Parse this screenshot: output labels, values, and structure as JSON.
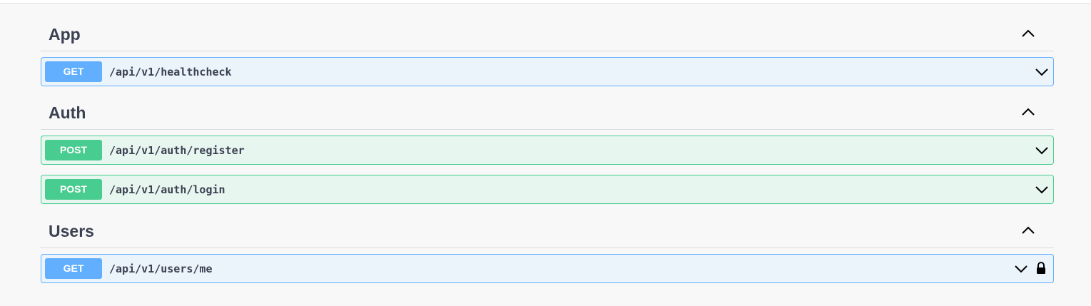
{
  "sections": [
    {
      "title": "App",
      "operations": [
        {
          "method": "GET",
          "path": "/api/v1/healthcheck",
          "locked": false
        }
      ]
    },
    {
      "title": "Auth",
      "operations": [
        {
          "method": "POST",
          "path": "/api/v1/auth/register",
          "locked": false
        },
        {
          "method": "POST",
          "path": "/api/v1/auth/login",
          "locked": false
        }
      ]
    },
    {
      "title": "Users",
      "operations": [
        {
          "method": "GET",
          "path": "/api/v1/users/me",
          "locked": true
        }
      ]
    }
  ],
  "colors": {
    "get_accent": "#61affe",
    "get_background": "#ebf3fb",
    "post_accent": "#49cc90",
    "post_background": "#e8f6f0",
    "text": "#3b4151"
  },
  "icons": {
    "section_toggle": "chevron-up-icon",
    "operation_toggle": "chevron-down-icon",
    "auth_required": "lock-icon"
  }
}
